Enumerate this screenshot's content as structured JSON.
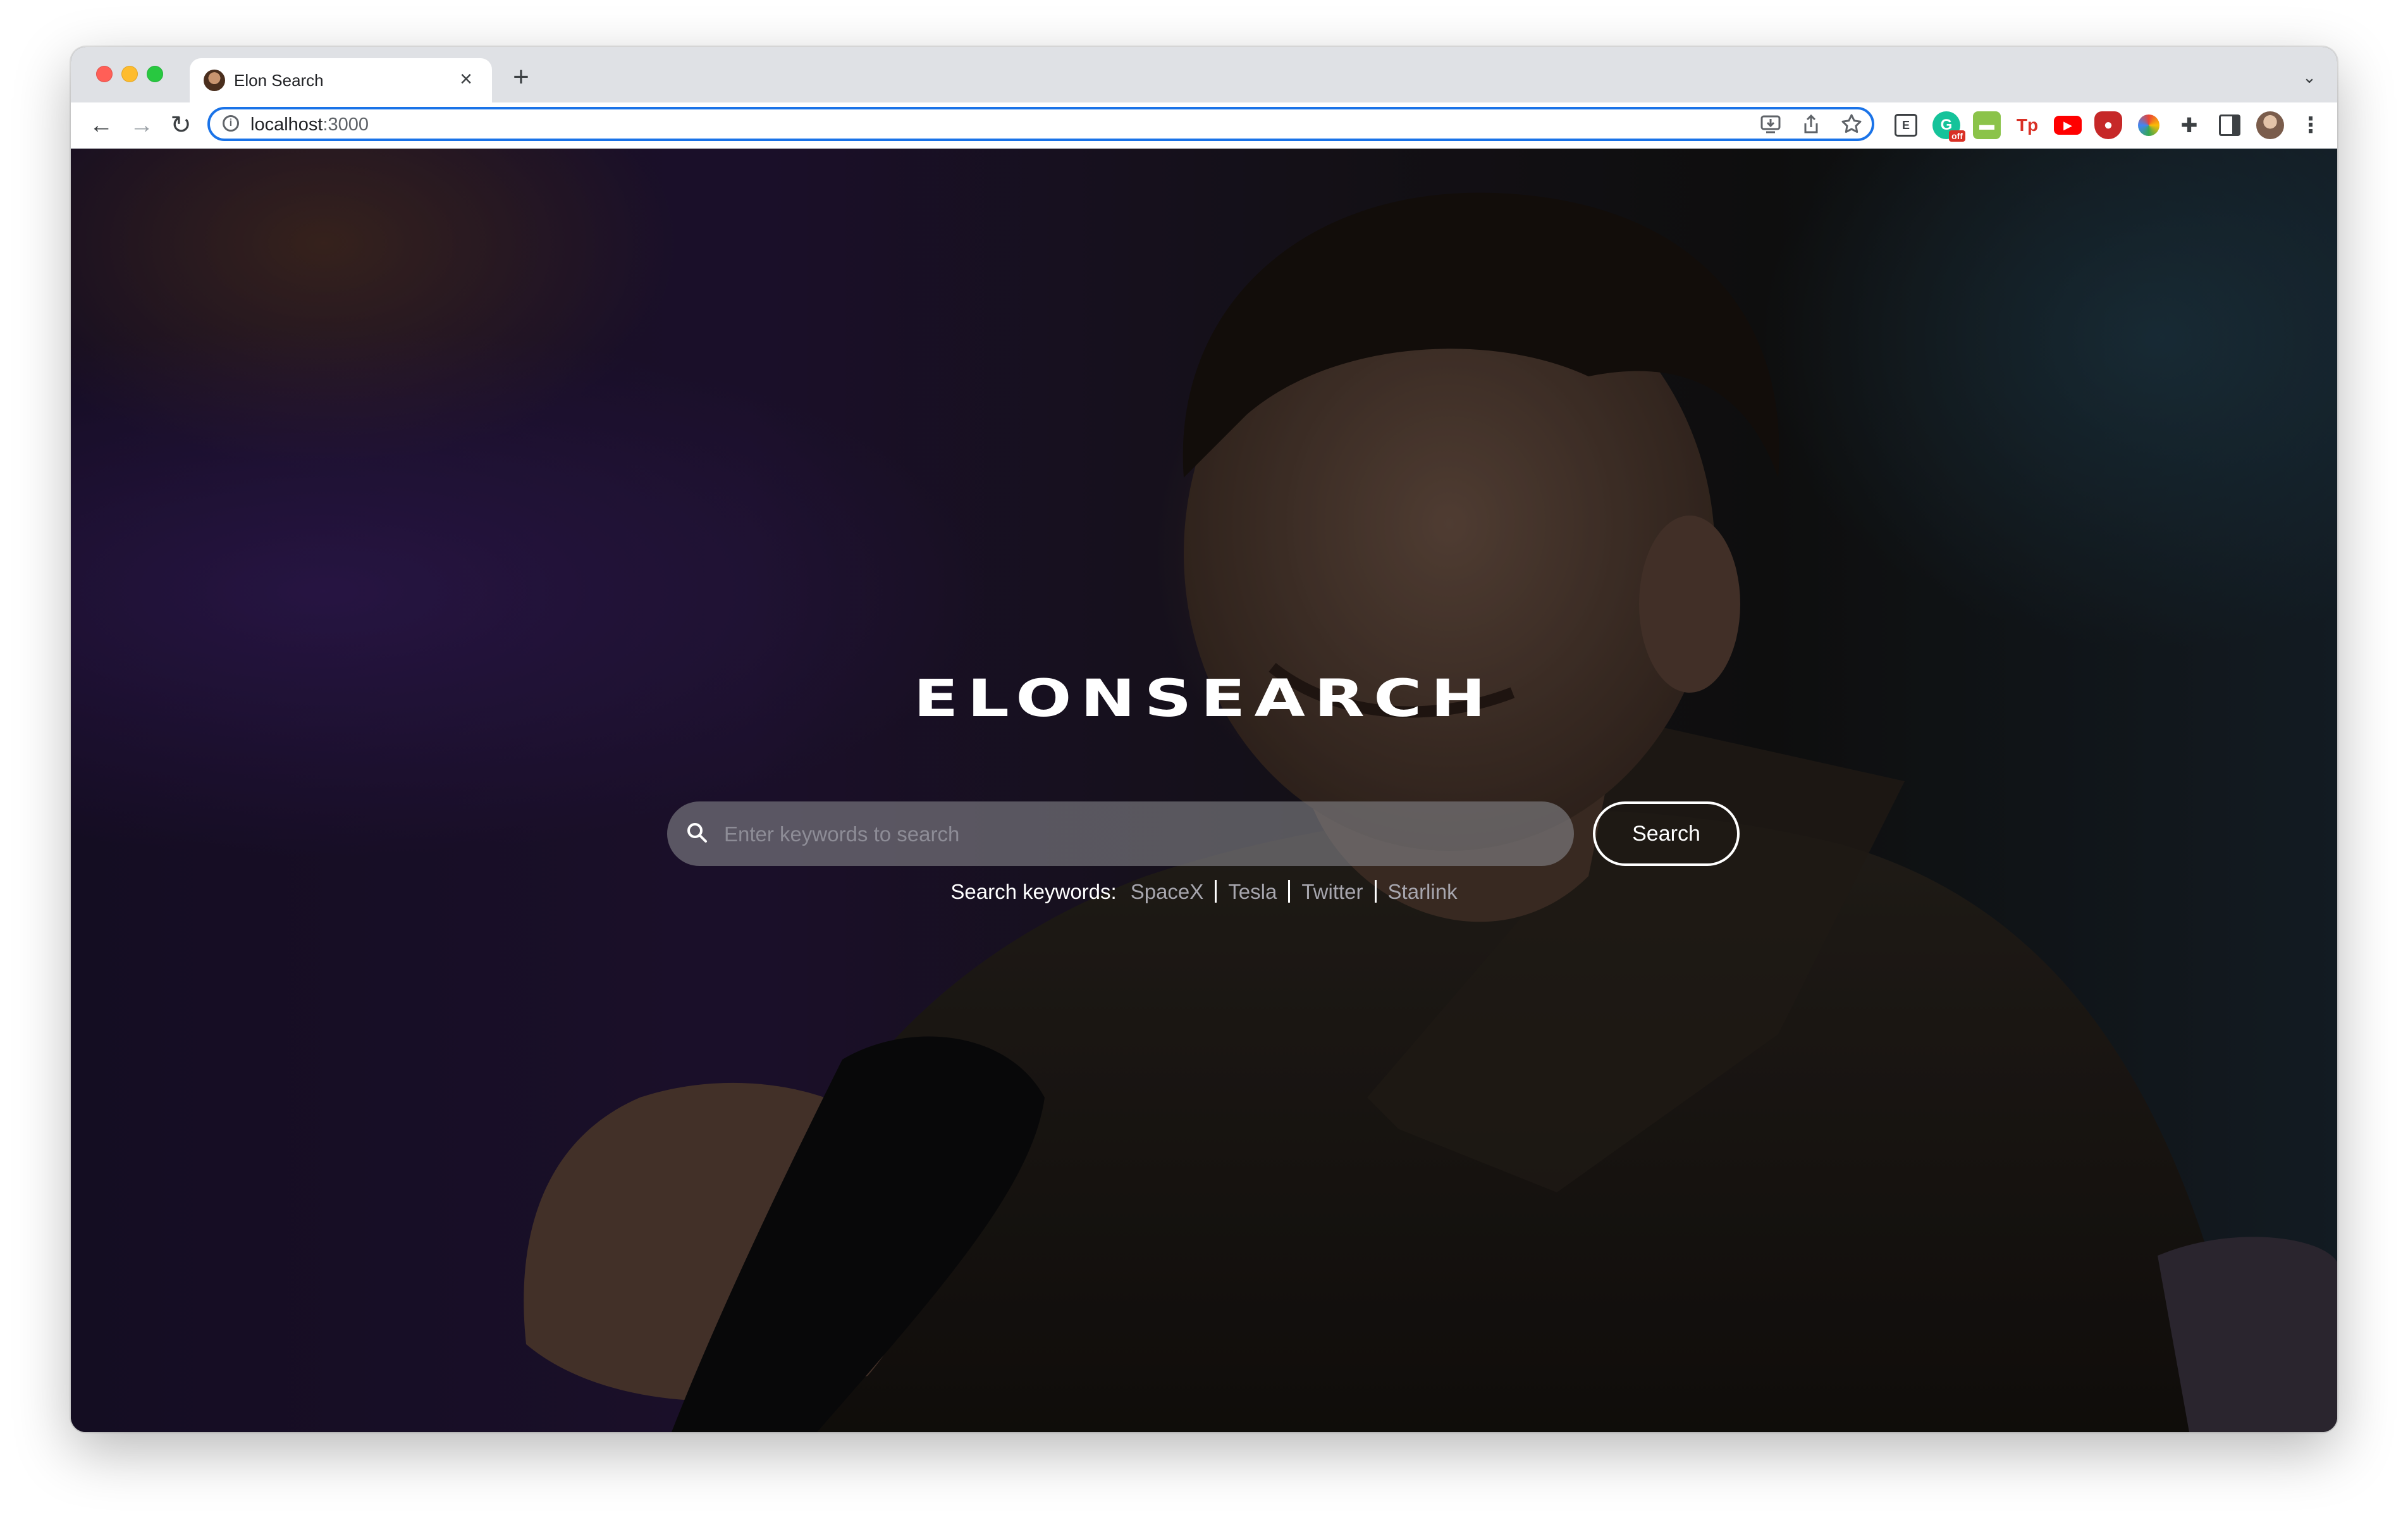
{
  "browser": {
    "tab_title": "Elon Search",
    "new_tab_symbol": "+",
    "tab_close_symbol": "×",
    "url_host": "localhost",
    "url_port": ":3000",
    "extensions": [
      "reader-icon",
      "grammarly-icon",
      "green-extension-icon",
      "tp-extension-icon",
      "youtube-extension-icon",
      "ublock-icon",
      "color-picker-icon",
      "extensions-puzzle-icon",
      "side-panel-icon",
      "profile-avatar",
      "menu-icon"
    ],
    "grammarly_badge": "off",
    "tp_label": "Tp"
  },
  "hero": {
    "logo_text": "ELONSEARCH",
    "search": {
      "placeholder": "Enter keywords to search",
      "value": ""
    },
    "search_button_label": "Search",
    "keywords_label": "Search keywords:",
    "keywords": [
      "SpaceX",
      "Tesla",
      "Twitter",
      "Starlink"
    ]
  },
  "colors": {
    "accent": "#1a73e8",
    "keyword_text": "#a7a6ae"
  }
}
